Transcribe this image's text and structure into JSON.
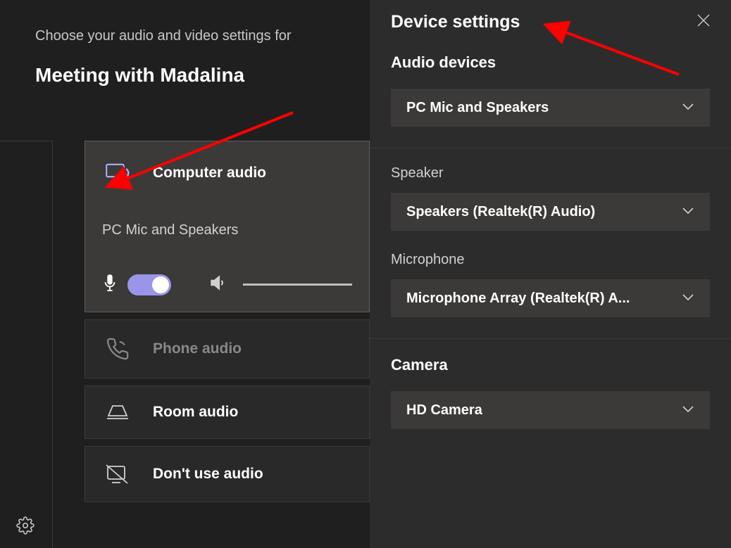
{
  "join": {
    "subtitle": "Choose your audio and video settings for",
    "title": "Meeting with Madalina"
  },
  "audio_options": {
    "computer": {
      "label": "Computer audio",
      "device": "PC Mic and Speakers"
    },
    "phone": {
      "label": "Phone audio"
    },
    "room": {
      "label": "Room audio"
    },
    "none": {
      "label": "Don't use audio"
    }
  },
  "settings": {
    "title": "Device settings",
    "audio_devices": {
      "label": "Audio devices",
      "selected": "PC Mic and Speakers"
    },
    "speaker": {
      "label": "Speaker",
      "selected": "Speakers (Realtek(R) Audio)"
    },
    "microphone": {
      "label": "Microphone",
      "selected": "Microphone Array (Realtek(R) A..."
    },
    "camera": {
      "label": "Camera",
      "selected": "HD Camera"
    }
  }
}
